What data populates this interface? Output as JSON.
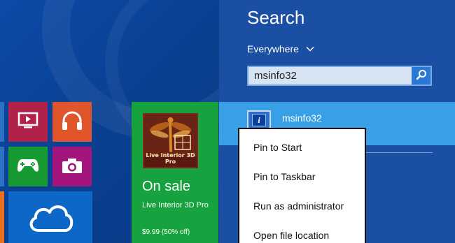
{
  "search": {
    "title": "Search",
    "scope": "Everywhere",
    "query": "msinfo32"
  },
  "results": [
    {
      "label": "msinfo32"
    }
  ],
  "context_menu": {
    "items": [
      "Pin to Start",
      "Pin to Taskbar",
      "Run as administrator",
      "Open file location"
    ]
  },
  "store_tile": {
    "app_icon_text": "Live Interior 3D Pro",
    "title": "On sale",
    "app_name": "Live Interior 3D Pro",
    "price": "$9.99 (50% off)"
  },
  "colors": {
    "search_pane": "#1a4fa3",
    "selected_result": "#39a0e8",
    "store_tile": "#16a23e",
    "video_tile": "#b1224b",
    "music_tile": "#e0552a",
    "games_tile": "#189a32",
    "camera_tile": "#a3157c",
    "onedrive_tile": "#0c67c7"
  },
  "icons": [
    "video-icon",
    "headphones-icon",
    "xbox-controller-icon",
    "camera-icon",
    "cloud-icon",
    "magnifier-icon",
    "chevron-down-icon",
    "system-info-icon"
  ]
}
